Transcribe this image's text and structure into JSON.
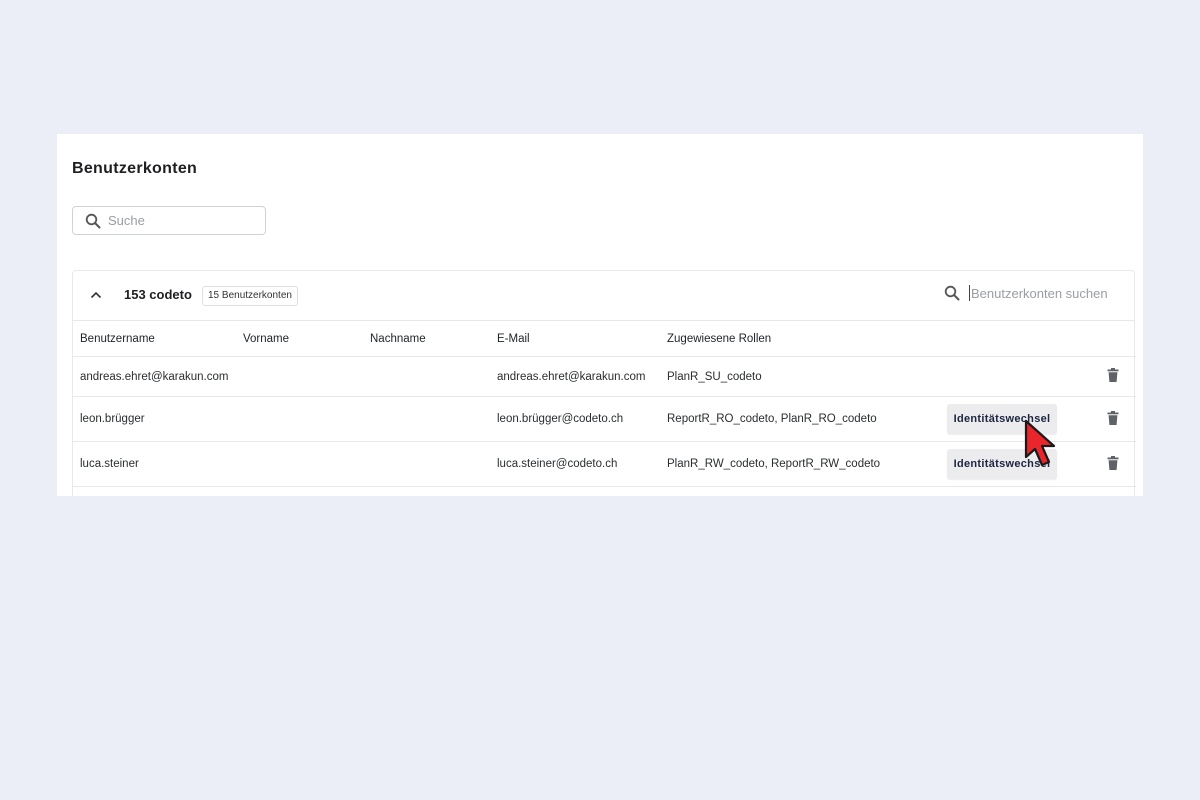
{
  "page": {
    "title": "Benutzerkonten"
  },
  "search": {
    "placeholder": "Suche",
    "value": ""
  },
  "group": {
    "name": "153 codeto",
    "count_badge": "15 Benutzerkonten",
    "expanded": true,
    "search_placeholder": "Benutzerkonten suchen"
  },
  "table": {
    "columns": [
      "Benutzername",
      "Vorname",
      "Nachname",
      "E-Mail",
      "Zugewiesene Rollen"
    ],
    "rows": [
      {
        "username": "andreas.ehret@karakun.com",
        "firstname": "",
        "lastname": "",
        "email": "andreas.ehret@karakun.com",
        "roles": "PlanR_SU_codeto",
        "action": ""
      },
      {
        "username": "leon.brügger",
        "firstname": "",
        "lastname": "",
        "email": "leon.brügger@codeto.ch",
        "roles": "ReportR_RO_codeto, PlanR_RO_codeto",
        "action": "Identitätswechsel"
      },
      {
        "username": "luca.steiner",
        "firstname": "",
        "lastname": "",
        "email": "luca.steiner@codeto.ch",
        "roles": "PlanR_RW_codeto, ReportR_RW_codeto",
        "action": "Identitätswechsel"
      }
    ]
  },
  "icons": {
    "search": "search-icon",
    "collapse": "chevron-up-icon",
    "delete": "trash-icon",
    "pointer": "cursor-arrow-icon"
  },
  "colors": {
    "background": "#ebeef7",
    "panel": "#ffffff",
    "button_bg": "#ececee",
    "cursor_fill": "#e8262b"
  }
}
